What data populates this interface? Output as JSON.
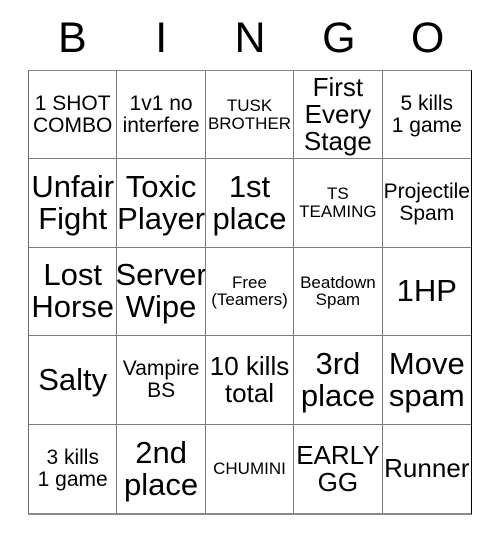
{
  "card": {
    "header_letters": [
      "B",
      "I",
      "N",
      "G",
      "O"
    ],
    "rows": [
      [
        {
          "text": "1 SHOT\nCOMBO",
          "size": "md"
        },
        {
          "text": "1v1 no\ninterfere",
          "size": "md"
        },
        {
          "text": "TUSK\nBROTHER",
          "size": "sm"
        },
        {
          "text": "First\nEvery\nStage",
          "size": "lg"
        },
        {
          "text": "5 kills\n1 game",
          "size": "md"
        }
      ],
      [
        {
          "text": "Unfair\nFight",
          "size": "xl"
        },
        {
          "text": "Toxic\nPlayer",
          "size": "xl"
        },
        {
          "text": "1st\nplace",
          "size": "xl"
        },
        {
          "text": "TS\nTEAMING",
          "size": "sm"
        },
        {
          "text": "Projectile\nSpam",
          "size": "md"
        }
      ],
      [
        {
          "text": "Lost\nHorse",
          "size": "xl"
        },
        {
          "text": "Server\nWipe",
          "size": "xl"
        },
        {
          "text": "Free\n(Teamers)",
          "size": "sm"
        },
        {
          "text": "Beatdown\nSpam",
          "size": "sm"
        },
        {
          "text": "1HP",
          "size": "xl"
        }
      ],
      [
        {
          "text": "Salty",
          "size": "xl"
        },
        {
          "text": "Vampire\nBS",
          "size": "md"
        },
        {
          "text": "10 kills\ntotal",
          "size": "lg"
        },
        {
          "text": "3rd\nplace",
          "size": "xl"
        },
        {
          "text": "Move\nspam",
          "size": "xl"
        }
      ],
      [
        {
          "text": "3 kills\n1 game",
          "size": "md"
        },
        {
          "text": "2nd\nplace",
          "size": "xl"
        },
        {
          "text": "CHUMINI",
          "size": "sm"
        },
        {
          "text": "EARLY\nGG",
          "size": "lg"
        },
        {
          "text": "Runner",
          "size": "lg"
        }
      ]
    ]
  },
  "colors": {
    "background": "#ffffff",
    "text": "#000000",
    "grid_line": "#7d7d7d",
    "outer_border_right": "#000000",
    "outer_border_bottom": "#8a8a8a"
  }
}
